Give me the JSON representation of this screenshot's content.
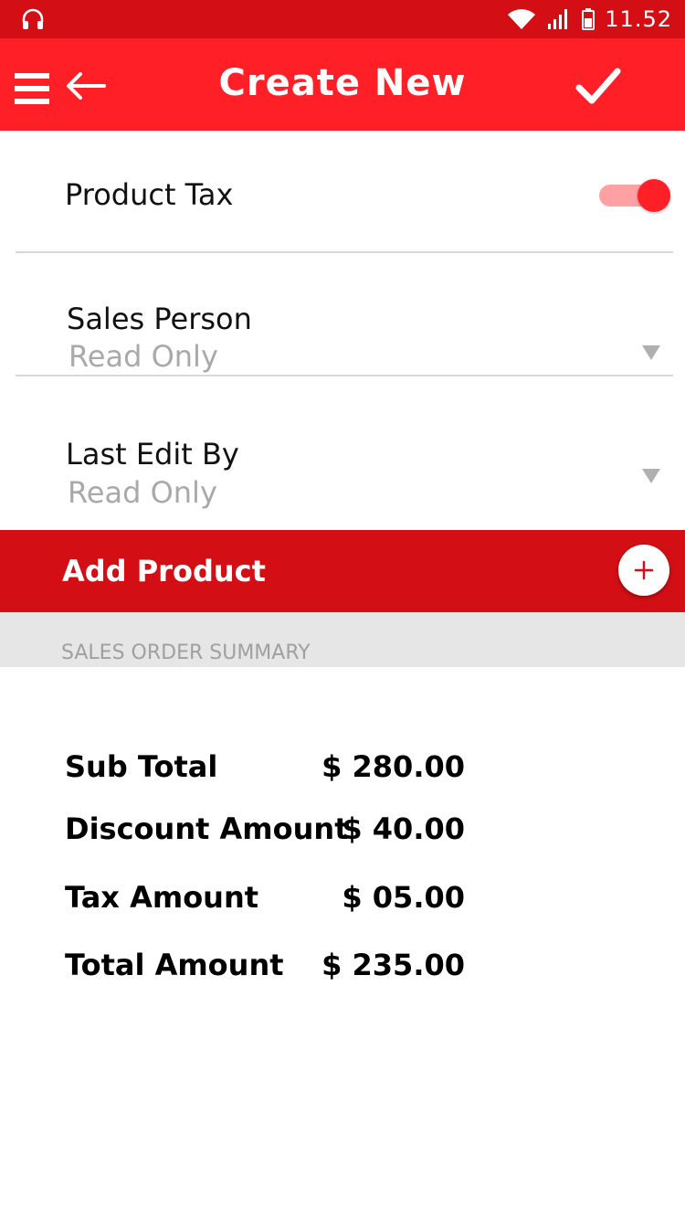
{
  "status_bar": {
    "time": "11.52",
    "icons": [
      "headset-icon",
      "wifi-icon",
      "signal-icon",
      "battery-icon"
    ]
  },
  "toolbar": {
    "title": "Create New",
    "icons": [
      "menu-icon",
      "back-arrow-icon",
      "check-icon"
    ]
  },
  "form": {
    "product_tax": {
      "label": "Product Tax",
      "enabled": true
    },
    "sales_person": {
      "label": "Sales Person",
      "value": "Read Only"
    },
    "last_edit_by": {
      "label": "Last Edit By",
      "value": "Read Only"
    }
  },
  "add_product": {
    "label": "Add Product"
  },
  "summary": {
    "header": "SALES ORDER SUMMARY",
    "rows": [
      {
        "label": "Sub Total",
        "value": "$ 280.00"
      },
      {
        "label": "Discount Amount",
        "value": "$ 40.00"
      },
      {
        "label": "Tax Amount",
        "value": "$ 05.00"
      },
      {
        "label": "Total Amount",
        "value": "$ 235.00"
      }
    ]
  },
  "colors": {
    "status_bar": "#d30f15",
    "toolbar": "#ff1f27",
    "add_bar": "#d30f15",
    "toggle_thumb": "#ff1f27",
    "toggle_track": "#ffa0a3",
    "muted_text": "#a9a9a9"
  }
}
